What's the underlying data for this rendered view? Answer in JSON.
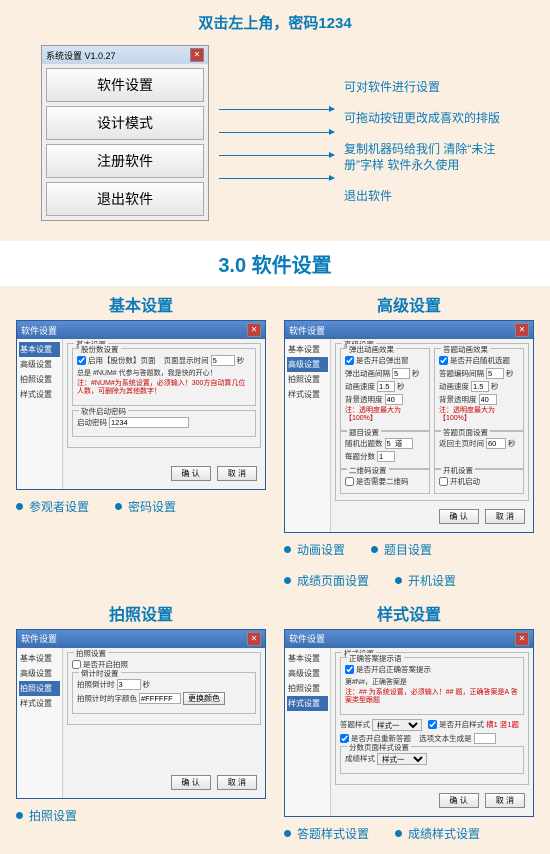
{
  "top": {
    "header": "双击左上角，密码1234",
    "win_title": "系统设置 V1.0.27",
    "buttons": [
      "软件设置",
      "设计模式",
      "注册软件",
      "退出软件"
    ],
    "descs": [
      "可对软件进行设置",
      "可拖动按钮更改成喜欢的排版",
      "复制机器码给我们 清除“未注册”字样 软件永久使用",
      "退出软件"
    ]
  },
  "band": "3.0 软件设置",
  "section1": {
    "left_title": "基本设置",
    "right_title": "高级设置",
    "dlg_title": "软件设置",
    "side": [
      "基本设置",
      "高级设置",
      "拍照设置",
      "样式设置"
    ],
    "basic": {
      "grp": "基本设置",
      "sub1": "股份数设置",
      "chk1": "启用【股份数】页面",
      "lbl_time": "页面显示时间",
      "val_time": "5",
      "unit": "秒",
      "tip1": "总是 #NUM# 代参与答题数，我是快的开心！",
      "warn1": "注：#NUM#为系统设置，必须输入！300方自动算几位人数，可删除为其他数字！",
      "sub2": "软件启动密码",
      "lbl_pwd": "启动密码",
      "val_pwd": "1234"
    },
    "adv": {
      "grp": "高级设置",
      "g1": "弹出动画效果",
      "g1_chk": "是否开启弹出窗",
      "g1_l1": "弹出动画间隔",
      "g1_v1": "5",
      "g1_l2": "动画速度",
      "g1_v2": "1.5",
      "g1_l3": "背景透明度",
      "g1_v3": "40",
      "g1_warn": "注：透明度最大为【100%】",
      "g2": "答题动画效果",
      "g2_chk": "是否开启随机选题",
      "g2_l1": "答题编码间隔",
      "g2_v1": "5",
      "g2_l2": "动画速度",
      "g2_v2": "1.5",
      "g2_l3": "背景透明度",
      "g2_v3": "40",
      "g3": "题目设置",
      "g3_l1": "随机出题数",
      "g3_v1": "5  道",
      "g3_l2": "每题分数",
      "g3_v2": "1",
      "g4": "答题页面设置",
      "g4_l1": "返回主页时间",
      "g4_v1": "60",
      "g5": "二维码设置",
      "g5_chk": "是否需要二维码",
      "g6": "开机设置",
      "g6_chk": "开机启动"
    },
    "bullets_l": [
      "参观者设置",
      "密码设置"
    ],
    "bullets_r": [
      "动画设置",
      "题目设置",
      "成绩页面设置",
      "开机设置"
    ]
  },
  "section2": {
    "left_title": "拍照设置",
    "right_title": "样式设置",
    "photo": {
      "grp": "拍照设置",
      "chk": "是否开启拍照",
      "sub": "倒计时设置",
      "l1": "拍照倒计时",
      "v1": "3",
      "l2": "拍照计时的字颜色",
      "v2": "#FFFFFF",
      "btn_color": "更换颜色"
    },
    "style": {
      "grp": "样式设置",
      "sub1": "正确答案提示语",
      "chk1": "是否开启正确答案提示",
      "tip": "第#N#，正确答案是",
      "warn": "注：## 为系统设置，必须输入！## 题，正确答案是A 答案类型跟题",
      "l_sel": "答题样式",
      "chk2": "是否开启样式",
      "chk2_v": "横1 竖1题",
      "chk3": "是否开启重新答题",
      "l_opt": "选项文本生成是",
      "sub2": "分数页面样式设置",
      "l_sel2": "成绩样式"
    },
    "bullets_l": [
      "拍照设置"
    ],
    "bullets_r": [
      "答题样式设置",
      "成绩样式设置"
    ]
  },
  "common": {
    "ok": "确  认",
    "cancel": "取  消",
    "opt": "样式一"
  }
}
